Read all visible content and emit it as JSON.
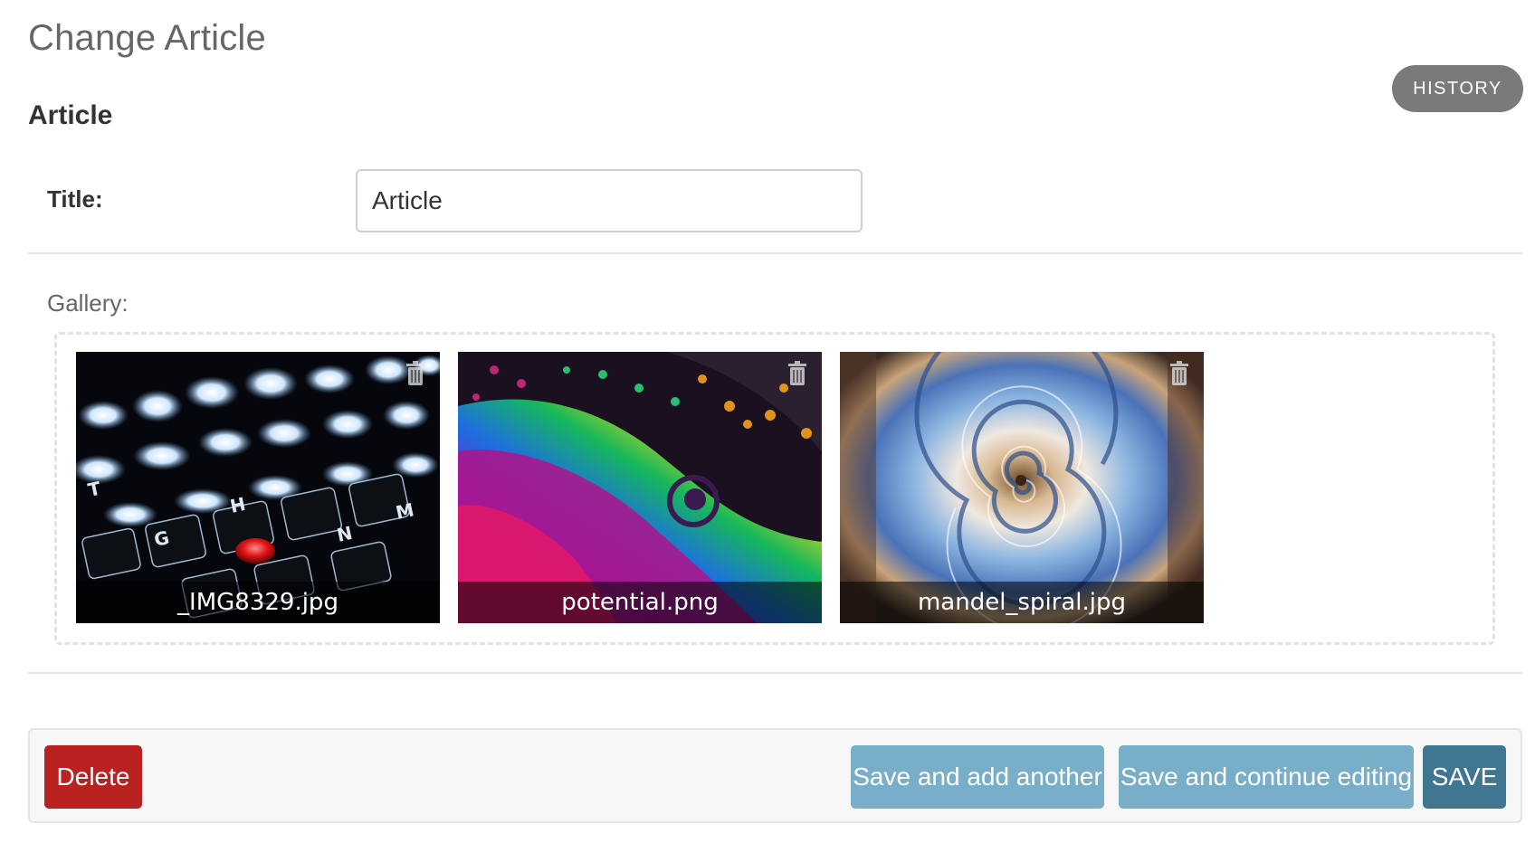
{
  "page": {
    "title": "Change Article",
    "history_label": "HISTORY"
  },
  "fieldset": {
    "title": "Article",
    "title_label": "Title:",
    "title_value": "Article",
    "gallery_label": "Gallery:"
  },
  "gallery": {
    "items": [
      {
        "filename": "_IMG8329.jpg",
        "icon": "trash-icon"
      },
      {
        "filename": "potential.png",
        "icon": "trash-icon"
      },
      {
        "filename": "mandel_spiral.jpg",
        "icon": "trash-icon"
      }
    ]
  },
  "actions": {
    "delete_label": "Delete",
    "save_add_label": "Save and add another",
    "save_continue_label": "Save and continue editing",
    "save_label": "SAVE"
  },
  "colors": {
    "delete": "#ba2121",
    "secondary": "#79aec8",
    "primary": "#417690",
    "history": "#7a7a7a"
  }
}
